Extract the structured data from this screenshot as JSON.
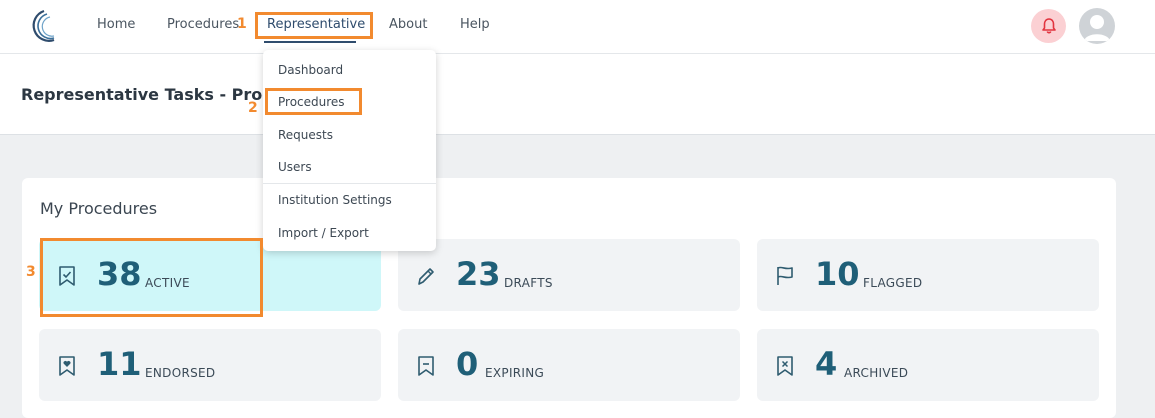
{
  "nav": {
    "home": "Home",
    "procedures": "Procedures",
    "representative": "Representative",
    "about": "About",
    "help": "Help"
  },
  "header": {
    "title": "Representative Tasks - Proce"
  },
  "dropdown": {
    "items": [
      "Dashboard",
      "Procedures",
      "Requests",
      "Users",
      "Institution Settings",
      "Import / Export"
    ]
  },
  "card": {
    "title": "My Procedures",
    "tiles": [
      {
        "count": "38",
        "label": "ACTIVE",
        "icon": "bookmark-check-icon"
      },
      {
        "count": "23",
        "label": "DRAFTS",
        "icon": "pencil-icon"
      },
      {
        "count": "10",
        "label": "FLAGGED",
        "icon": "flag-icon"
      },
      {
        "count": "11",
        "label": "ENDORSED",
        "icon": "bookmark-heart-icon"
      },
      {
        "count": "0",
        "label": "EXPIRING",
        "icon": "bookmark-dash-icon"
      },
      {
        "count": "4",
        "label": "ARCHIVED",
        "icon": "bookmark-x-icon"
      }
    ]
  },
  "annotations": [
    "1",
    "2",
    "3"
  ],
  "colors": {
    "accent": "#f28a2f",
    "highlight_tile": "#cff7f9",
    "count_text": "#1f5f78",
    "nav_active": "#2f4c6d",
    "bell_bg": "#fbd0d3",
    "bell_icon": "#e2343f"
  }
}
